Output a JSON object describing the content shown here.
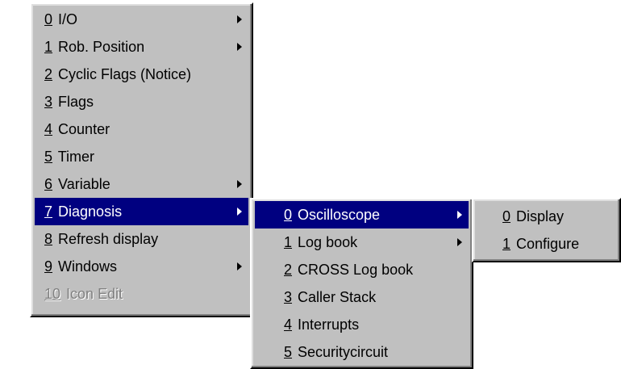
{
  "main_menu": {
    "items": [
      {
        "num": "0",
        "text": "I/O",
        "submenu": true
      },
      {
        "num": "1",
        "text": "Rob. Position",
        "submenu": true
      },
      {
        "num": "2",
        "text": "Cyclic Flags (Notice)",
        "submenu": false
      },
      {
        "num": "3",
        "text": "Flags",
        "submenu": false
      },
      {
        "num": "4",
        "text": "Counter",
        "submenu": false
      },
      {
        "num": "5",
        "text": "Timer",
        "submenu": false
      },
      {
        "num": "6",
        "text": "Variable",
        "submenu": true
      },
      {
        "num": "7",
        "text": "Diagnosis",
        "submenu": true,
        "selected": true
      },
      {
        "num": "8",
        "text": "Refresh display",
        "submenu": false
      },
      {
        "num": "9",
        "text": "Windows",
        "submenu": true
      },
      {
        "num": "10",
        "text": "Icon Edit",
        "submenu": false,
        "disabled": true
      }
    ]
  },
  "diagnosis_menu": {
    "items": [
      {
        "num": "0",
        "text": "Oscilloscope",
        "submenu": true,
        "selected": true
      },
      {
        "num": "1",
        "text": "Log book",
        "submenu": true
      },
      {
        "num": "2",
        "text": "CROSS Log book",
        "submenu": false
      },
      {
        "num": "3",
        "text": "Caller Stack",
        "submenu": false
      },
      {
        "num": "4",
        "text": "Interrupts",
        "submenu": false
      },
      {
        "num": "5",
        "text": "Securitycircuit",
        "submenu": false
      }
    ]
  },
  "oscilloscope_menu": {
    "items": [
      {
        "num": "0",
        "text": "Display",
        "submenu": false
      },
      {
        "num": "1",
        "text": "Configure",
        "submenu": false
      }
    ]
  },
  "colors": {
    "menu_bg": "#c0c0c0",
    "highlight": "#000080",
    "disabled_text": "#808080"
  }
}
